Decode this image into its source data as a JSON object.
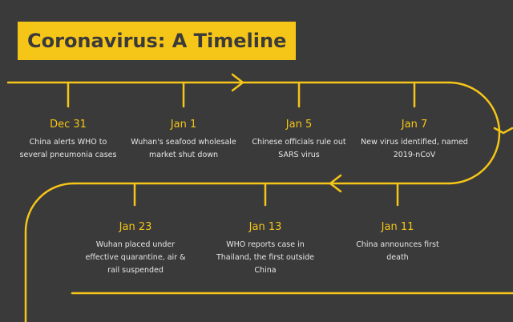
{
  "title": "Coronavirus: A Timeline",
  "colors": {
    "background": "#3a3a3a",
    "accent": "#f5c518",
    "text": "#e6e6e6"
  },
  "events": [
    {
      "date": "Dec 31",
      "desc": "China alerts WHO to several pneumonia cases"
    },
    {
      "date": "Jan 1",
      "desc": "Wuhan's seafood wholesale market shut down"
    },
    {
      "date": "Jan 5",
      "desc": "Chinese officials rule out SARS virus"
    },
    {
      "date": "Jan 7",
      "desc": "New virus identified, named 2019-nCoV"
    },
    {
      "date": "Jan 11",
      "desc": "China announces first death"
    },
    {
      "date": "Jan 13",
      "desc": "WHO reports case in Thailand, the first outside China"
    },
    {
      "date": "Jan 23",
      "desc": "Wuhan placed under effective quarantine, air & rail suspended"
    }
  ]
}
